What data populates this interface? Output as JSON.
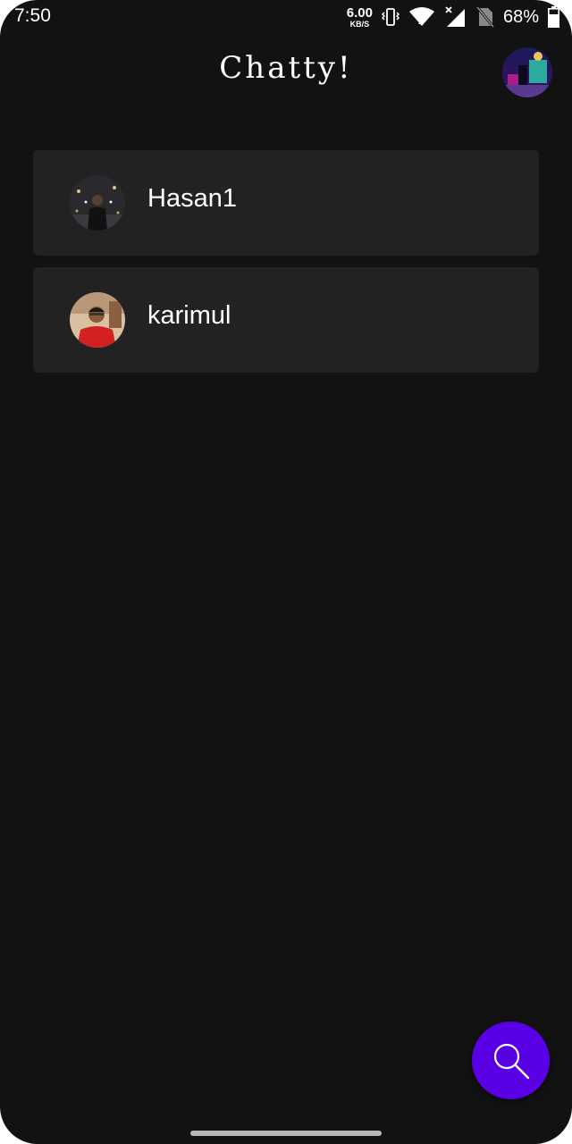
{
  "status_bar": {
    "time": "7:50",
    "net_speed_value": "6.00",
    "net_speed_unit": "KB/S",
    "battery_percent": "68%",
    "icons": [
      "vibrate-icon",
      "wifi-icon",
      "signal-icon",
      "no-sim-icon",
      "battery-icon"
    ]
  },
  "app_bar": {
    "title": "Chatty!",
    "profile_avatar_icon": "profile-avatar"
  },
  "chats": [
    {
      "name": "Hasan1"
    },
    {
      "name": "karimul"
    }
  ],
  "fab": {
    "icon": "search-icon",
    "color": "#5a00e4"
  },
  "colors": {
    "background": "#121212",
    "card": "#222222",
    "accent": "#5a00e4"
  }
}
